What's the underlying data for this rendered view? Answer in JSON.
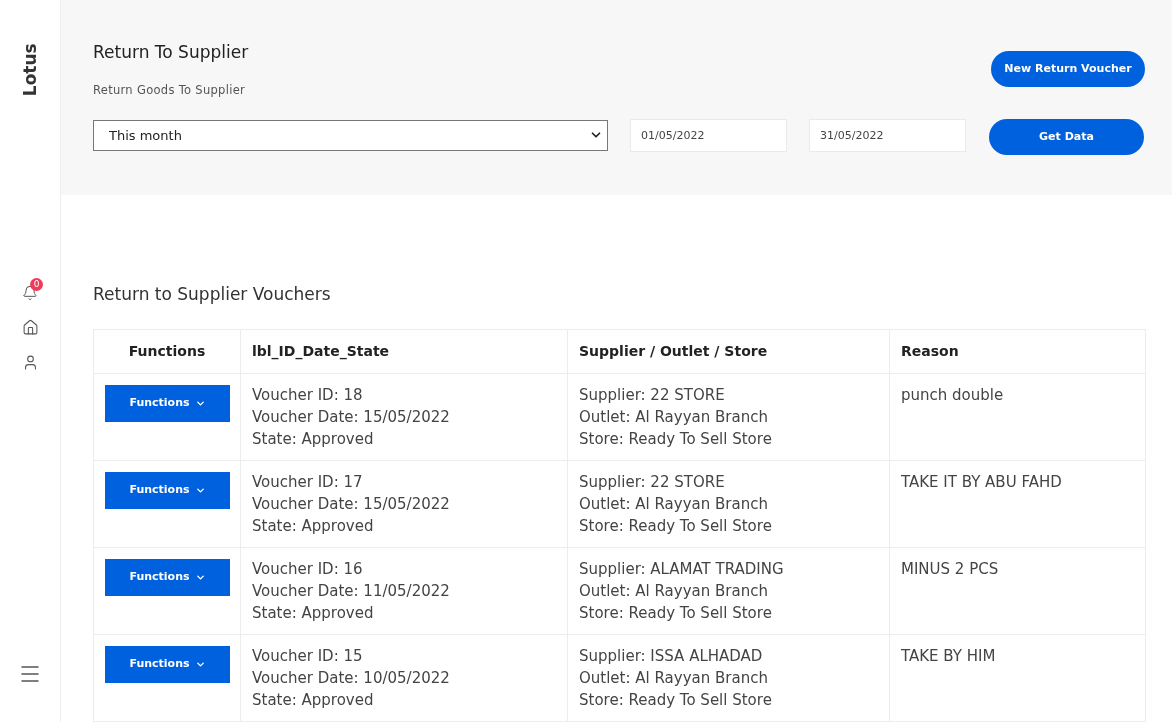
{
  "sidebar": {
    "brand": "Lotus",
    "notification_count": "0"
  },
  "header": {
    "title": "Return To Supplier",
    "subtitle": "Return Goods To Supplier",
    "period": "This month",
    "date_from": "01/05/2022",
    "date_to": "31/05/2022",
    "new_button": "New Return Voucher",
    "get_button": "Get Data"
  },
  "table": {
    "title": "Return to Supplier Vouchers",
    "columns": [
      "Functions",
      "lbl_ID_Date_State",
      "Supplier / Outlet / Store",
      "Reason"
    ],
    "rows": [
      {
        "functions": "Functions",
        "id": "Voucher ID: 18",
        "date": "Voucher Date: 15/05/2022",
        "state": "State: Approved",
        "supplier": "Supplier: 22 STORE",
        "outlet": "Outlet: Al Rayyan Branch",
        "store": "Store: Ready To Sell Store",
        "reason": "punch double"
      },
      {
        "functions": "Functions",
        "id": "Voucher ID: 17",
        "date": "Voucher Date: 15/05/2022",
        "state": "State: Approved",
        "supplier": "Supplier: 22 STORE",
        "outlet": "Outlet: Al Rayyan Branch",
        "store": "Store: Ready To Sell Store",
        "reason": "TAKE IT BY ABU FAHD"
      },
      {
        "functions": "Functions",
        "id": "Voucher ID: 16",
        "date": "Voucher Date: 11/05/2022",
        "state": "State: Approved",
        "supplier": "Supplier: ALAMAT TRADING",
        "outlet": "Outlet: Al Rayyan Branch",
        "store": "Store: Ready To Sell Store",
        "reason": "MINUS 2 PCS"
      },
      {
        "functions": "Functions",
        "id": "Voucher ID: 15",
        "date": "Voucher Date: 10/05/2022",
        "state": "State: Approved",
        "supplier": "Supplier: ISSA ALHADAD",
        "outlet": "Outlet: Al Rayyan Branch",
        "store": "Store: Ready To Sell Store",
        "reason": "TAKE BY HIM"
      }
    ]
  }
}
